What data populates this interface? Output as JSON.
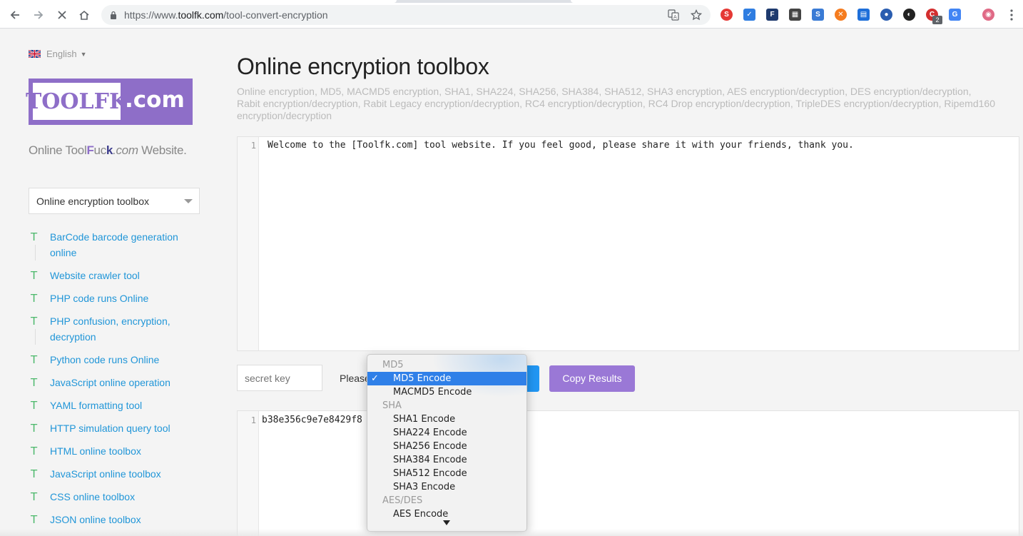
{
  "browser": {
    "url_scheme": "https://www.",
    "url_host": "toolfk.com",
    "url_path": "/tool-convert-encryption",
    "extension_badge": "2"
  },
  "sidebar": {
    "language": "English",
    "logo_text": "TOOLFK",
    "logo_domain": ".com",
    "tagline": {
      "part1": "Online Tool",
      "part2": "F",
      "part3": "uc",
      "part4": "k",
      "part5": ".com",
      "part6": " Website."
    },
    "category_select": "Online encryption toolbox",
    "items": [
      {
        "label": "BarCode barcode generation online"
      },
      {
        "label": "Website crawler tool"
      },
      {
        "label": "PHP code runs Online"
      },
      {
        "label": "PHP confusion, encryption, decryption"
      },
      {
        "label": "Python code runs Online"
      },
      {
        "label": "JavaScript online operation"
      },
      {
        "label": "YAML formatting tool"
      },
      {
        "label": "HTTP simulation query tool"
      },
      {
        "label": "HTML online toolbox"
      },
      {
        "label": "JavaScript online toolbox"
      },
      {
        "label": "CSS online toolbox"
      },
      {
        "label": "JSON online toolbox"
      }
    ],
    "item_marker": "T"
  },
  "main": {
    "title": "Online encryption toolbox",
    "description": "Online encryption, MD5, MACMD5 encryption, SHA1, SHA224, SHA256, SHA384, SHA512, SHA3 encryption, AES encryption/decryption, DES encryption/decryption, Rabit encryption/decryption, Rabit Legacy encryption/decryption, RC4 encryption/decryption, RC4 Drop encryption/decryption, TripleDES encryption/decryption, Ripemd160 encryption/decryption",
    "input_editor": {
      "line_number": "1",
      "text": "Welcome to the [Toolfk.com] tool website. If you feel good, please share it with your friends, thank you."
    },
    "secret_key_placeholder": "secret key",
    "please_label": "Please",
    "copy_button": "Copy Results",
    "output_editor": {
      "line_number": "1",
      "text": "b38e356c9e7e8429f8"
    }
  },
  "dropdown": {
    "check": "✓",
    "rows": [
      {
        "kind": "group",
        "label": "MD5"
      },
      {
        "kind": "option",
        "label": "MD5 Encode",
        "selected": true
      },
      {
        "kind": "option",
        "label": "MACMD5 Encode"
      },
      {
        "kind": "group",
        "label": "SHA"
      },
      {
        "kind": "option",
        "label": "SHA1 Encode"
      },
      {
        "kind": "option",
        "label": "SHA224 Encode"
      },
      {
        "kind": "option",
        "label": "SHA256 Encode"
      },
      {
        "kind": "option",
        "label": "SHA384 Encode"
      },
      {
        "kind": "option",
        "label": "SHA512 Encode"
      },
      {
        "kind": "option",
        "label": "SHA3 Encode"
      },
      {
        "kind": "group",
        "label": "AES/DES"
      },
      {
        "kind": "option",
        "label": "AES Encode"
      }
    ]
  },
  "colors": {
    "accent_purple": "#8e6ec8",
    "link_blue": "#2196d8",
    "marker_green": "#4cb86b",
    "run_button_blue": "#2196f3",
    "copy_button_purple": "#9a78d6",
    "selected_option": "#2f80e8"
  }
}
